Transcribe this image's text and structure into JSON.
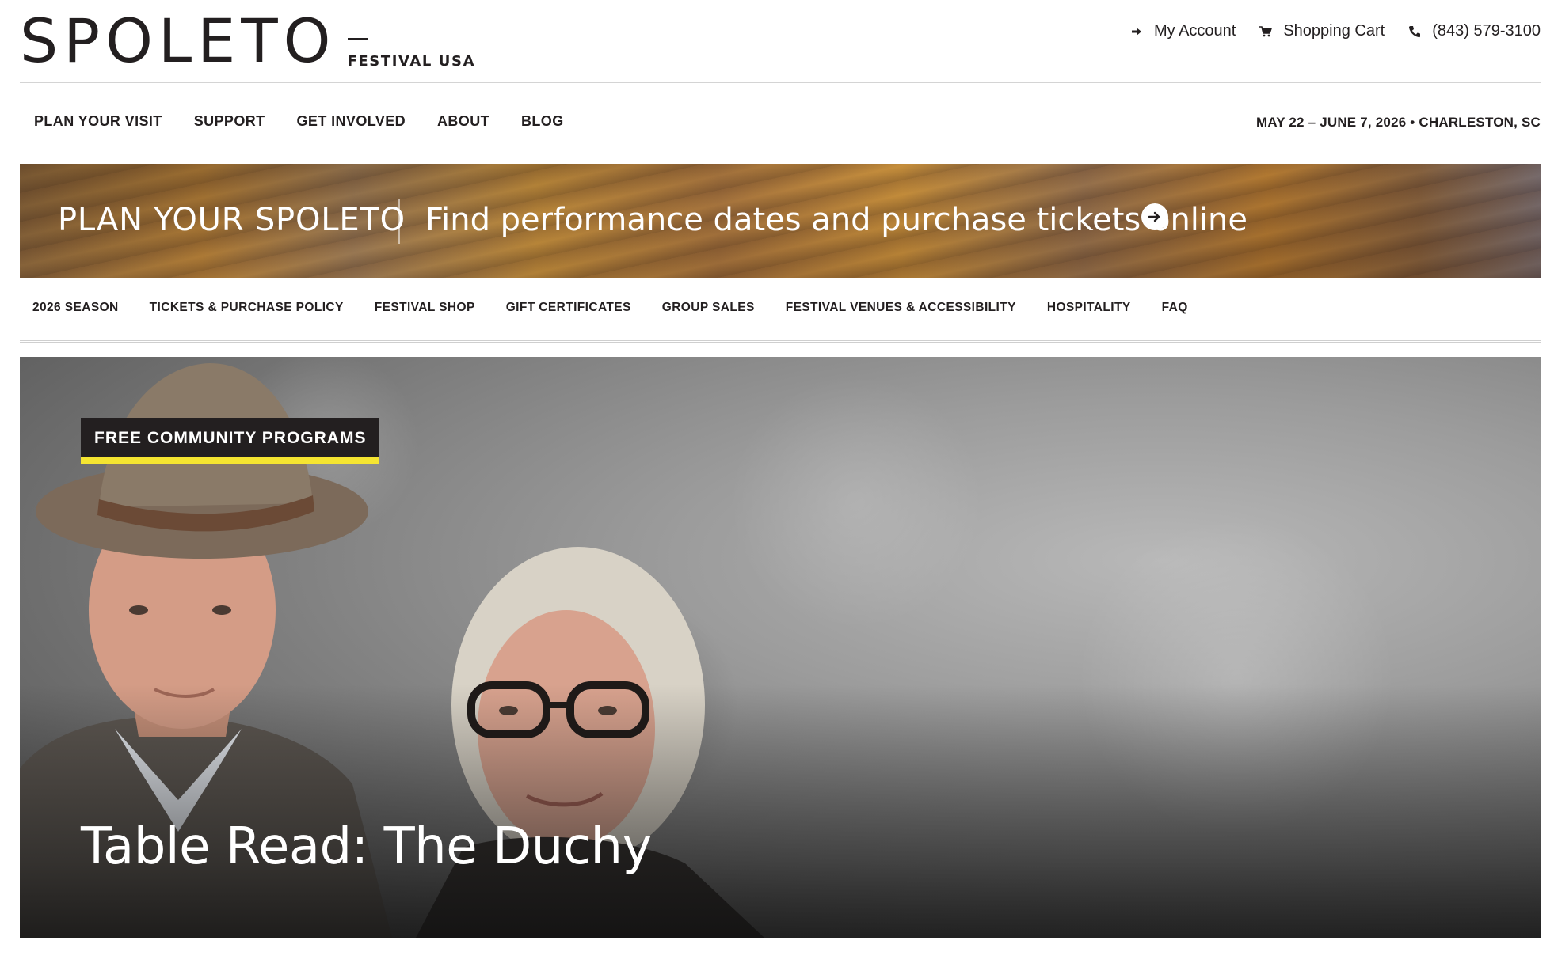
{
  "header": {
    "logo_word": "SPOLETO",
    "logo_sub": "FESTIVAL USA",
    "utility": [
      {
        "label": "My Account",
        "icon": "arrow-right-icon"
      },
      {
        "label": "Shopping Cart",
        "icon": "cart-icon"
      },
      {
        "label": "(843) 579-3100",
        "icon": "phone-icon"
      }
    ]
  },
  "main_nav": {
    "items": [
      "PLAN YOUR VISIT",
      "SUPPORT",
      "GET INVOLVED",
      "ABOUT",
      "BLOG"
    ],
    "dates": "MAY 22 – JUNE 7, 2026 • CHARLESTON, SC"
  },
  "promo": {
    "title": "PLAN YOUR SPOLETO",
    "text": "Find performance dates and purchase tickets online",
    "arrow_icon": "arrow-circle-icon"
  },
  "sub_nav": {
    "items": [
      "2026 SEASON",
      "TICKETS & PURCHASE POLICY",
      "FESTIVAL SHOP",
      "GIFT CERTIFICATES",
      "GROUP SALES",
      "FESTIVAL VENUES & ACCESSIBILITY",
      "HOSPITALITY",
      "FAQ"
    ]
  },
  "hero": {
    "badge": "FREE COMMUNITY PROGRAMS",
    "title": "Table Read: The Duchy"
  },
  "colors": {
    "text_dark": "#231f20",
    "badge_accent": "#f5e531",
    "white": "#ffffff"
  }
}
